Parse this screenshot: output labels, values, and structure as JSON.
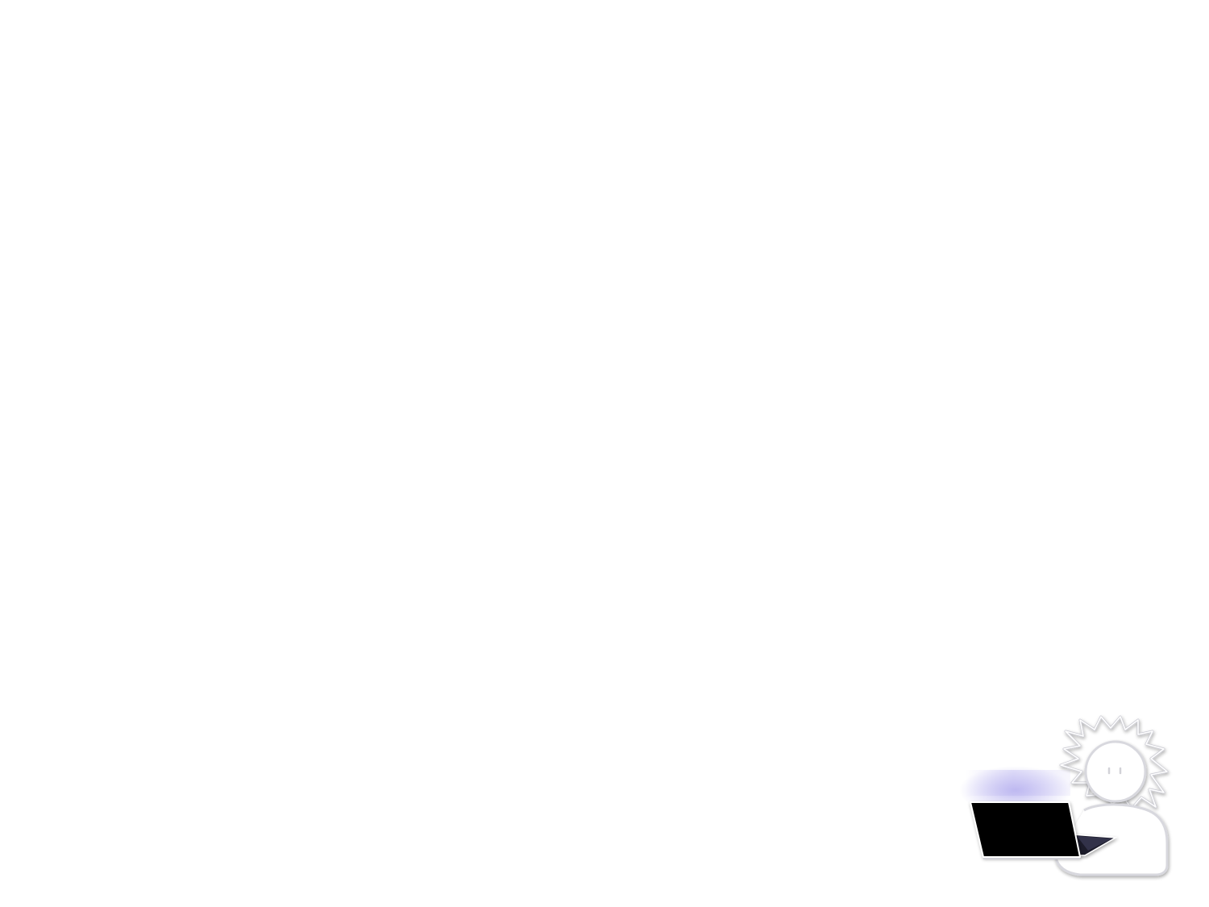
{
  "canvas": {
    "background": "#ffffff"
  },
  "illustration": {
    "icon": "person-with-laptop-icon",
    "colors": {
      "outline": "#e6e6ea",
      "outline_shadow": "#c9c9d2",
      "laptop": "#000000",
      "glow": "#b9b3f0"
    }
  }
}
